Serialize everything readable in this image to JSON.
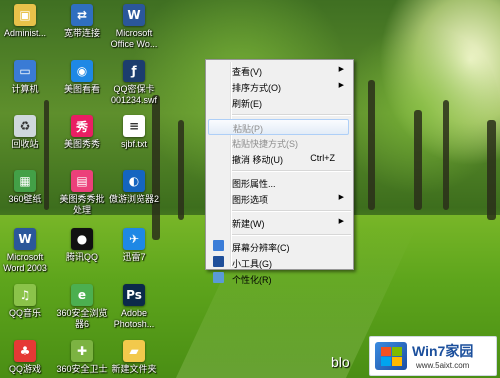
{
  "desktop_icons": [
    {
      "label": "Administ...",
      "icon": "user-folder-icon",
      "color": "#e8c24a"
    },
    {
      "label": "宽带连接",
      "icon": "network-connection-icon",
      "color": "#2f6fbf"
    },
    {
      "label": "Microsoft\nOffice Wo...",
      "icon": "word-icon",
      "color": "#2b579a"
    },
    {
      "label": "计算机",
      "icon": "computer-icon",
      "color": "#3a7bd5"
    },
    {
      "label": "美图看看",
      "icon": "meitu-viewer-icon",
      "color": "#1e88e5"
    },
    {
      "label": "QQ密保卡\n001234.swf",
      "icon": "swf-file-icon",
      "color": "#1c3d6e"
    },
    {
      "label": "回收站",
      "icon": "recycle-bin-icon",
      "color": "#cfd8dc"
    },
    {
      "label": "美图秀秀",
      "icon": "meitu-xiuxiu-icon",
      "color": "#e91e63"
    },
    {
      "label": "sjbf.txt",
      "icon": "text-file-icon",
      "color": "#ffffff"
    },
    {
      "label": "360壁纸",
      "icon": "wallpaper-icon",
      "color": "#43a047"
    },
    {
      "label": "美图秀秀批\n处理",
      "icon": "meitu-batch-icon",
      "color": "#ec407a"
    },
    {
      "label": "傲游浏览器2",
      "icon": "maxthon-icon",
      "color": "#1565c0"
    },
    {
      "label": "Microsoft\nWord 2003",
      "icon": "word-2003-icon",
      "color": "#2b579a"
    },
    {
      "label": "腾讯QQ",
      "icon": "qq-icon",
      "color": "#111111"
    },
    {
      "label": "迅雷7",
      "icon": "thunder-icon",
      "color": "#1e88e5"
    },
    {
      "label": "QQ音乐",
      "icon": "qq-music-icon",
      "color": "#8bc34a"
    },
    {
      "label": "360安全浏览\n器6",
      "icon": "360-browser-icon",
      "color": "#4caf50"
    },
    {
      "label": "Adobe\nPhotosh...",
      "icon": "photoshop-icon",
      "color": "#0b2a4a"
    },
    {
      "label": "QQ游戏",
      "icon": "qq-game-icon",
      "color": "#e53935"
    },
    {
      "label": "360安全卫士",
      "icon": "360-safe-icon",
      "color": "#7cb342"
    },
    {
      "label": "新建文件夹",
      "icon": "folder-icon",
      "color": "#f2c94c"
    }
  ],
  "context_menu": {
    "items": [
      {
        "label": "查看(V)",
        "submenu": true
      },
      {
        "label": "排序方式(O)",
        "submenu": true
      },
      {
        "label": "刷新(E)"
      },
      {
        "separator": true
      },
      {
        "label": "粘贴(P)",
        "disabled": true,
        "highlighted": true
      },
      {
        "label": "粘贴快捷方式(S)",
        "disabled": true
      },
      {
        "label": "撤消 移动(U)",
        "shortcut": "Ctrl+Z"
      },
      {
        "separator": true
      },
      {
        "label": "图形属性...",
        "submenu": false
      },
      {
        "label": "图形选项",
        "submenu": true
      },
      {
        "separator": true
      },
      {
        "label": "新建(W)",
        "submenu": true
      },
      {
        "separator": true
      },
      {
        "label": "屏幕分辨率(C)",
        "icon": "screen-resolution-icon"
      },
      {
        "label": "小工具(G)",
        "icon": "gadgets-icon"
      },
      {
        "label": "个性化(R)",
        "icon": "personalize-icon"
      }
    ],
    "submenu_arrow": "▶"
  },
  "watermark": {
    "prefix_text": "blo",
    "title": "Win7家园",
    "url": "www.5aixt.com"
  },
  "colors": {
    "menu_bg": "#f0f0f0",
    "highlight_border": "#aecff7",
    "disabled_text": "#8d8d8d"
  }
}
